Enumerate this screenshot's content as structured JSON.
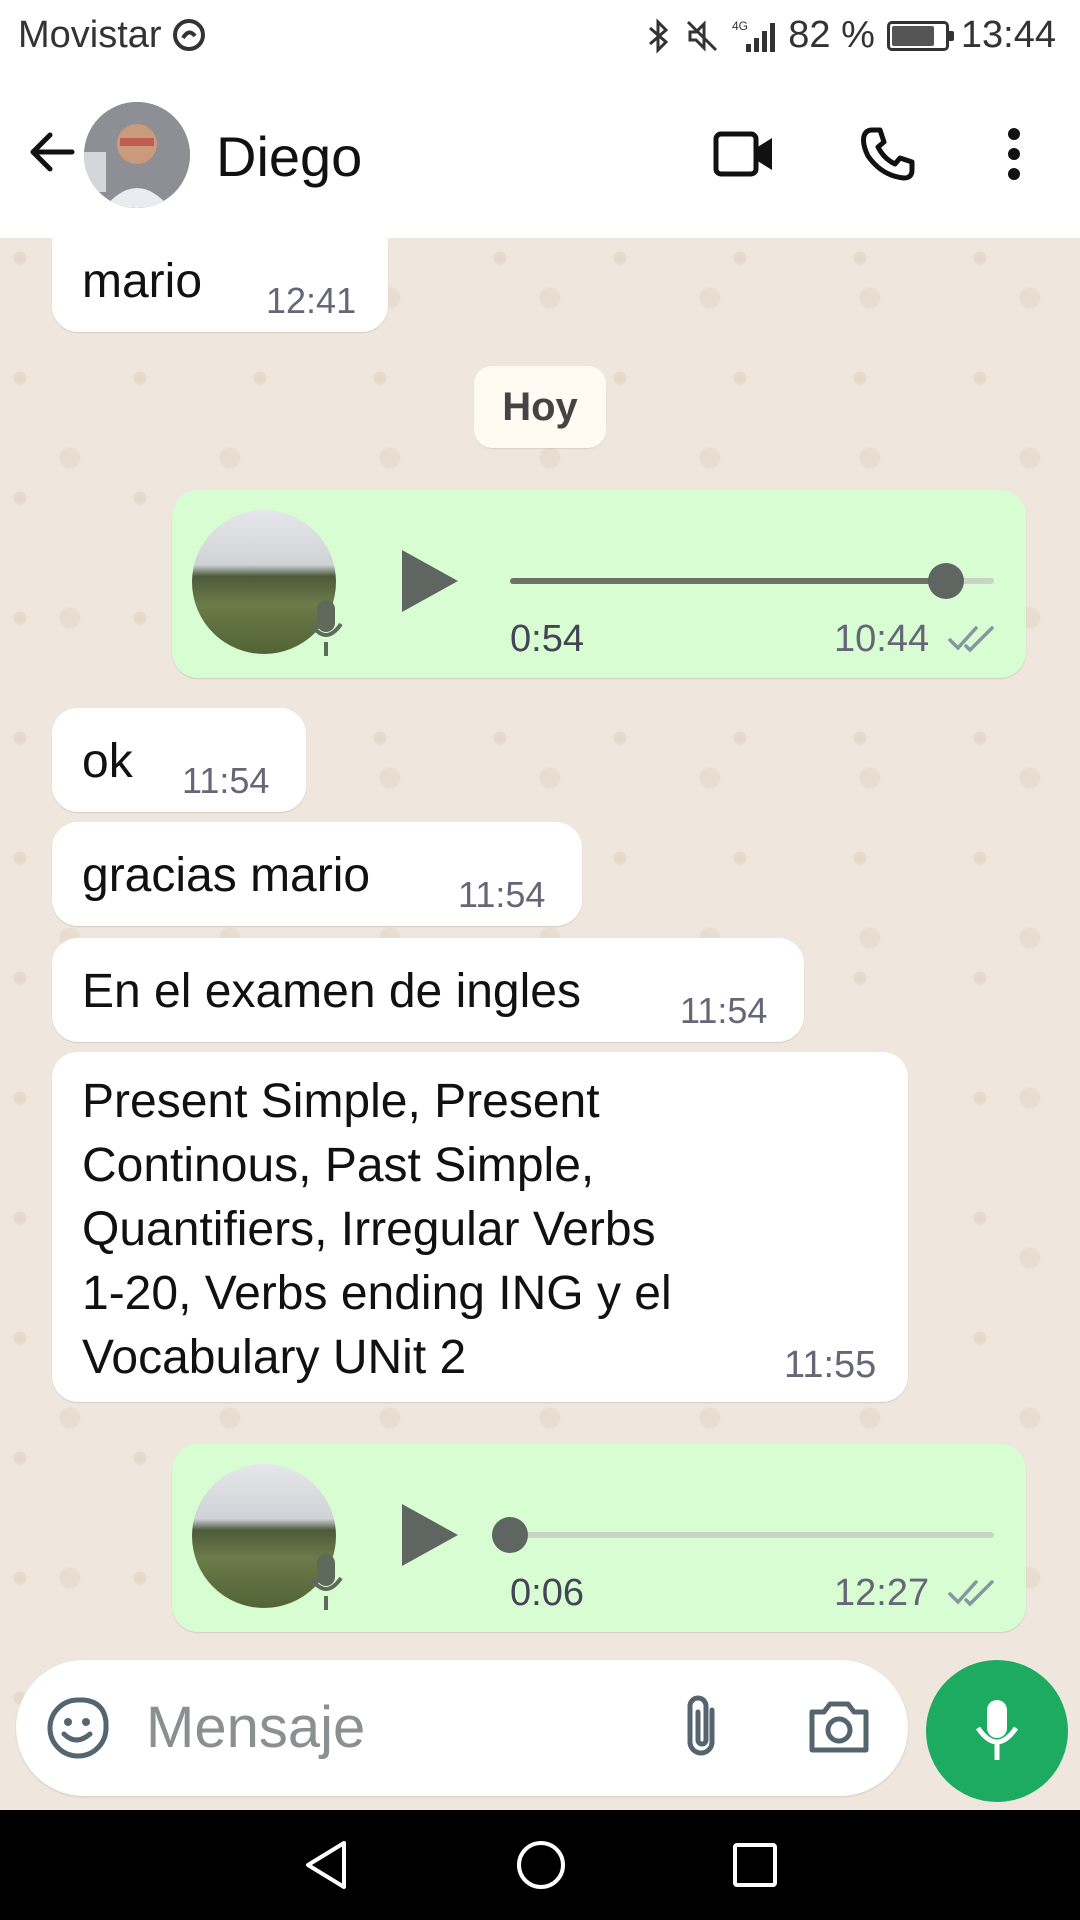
{
  "status_bar": {
    "carrier": "Movistar",
    "battery": "82 %",
    "battery_level": 0.82,
    "time": "13:44",
    "network": "4G"
  },
  "header": {
    "contact_name": "Diego"
  },
  "messages": {
    "m1": {
      "text": "mario",
      "time": "12:41"
    },
    "date_chip": "Hoy",
    "voice1": {
      "duration": "0:54",
      "time": "10:44",
      "progress": 0.9
    },
    "m2": {
      "text": "ok",
      "time": "11:54"
    },
    "m3": {
      "text": "gracias mario",
      "time": "11:54"
    },
    "m4": {
      "text": "En el examen de ingles",
      "time": "11:54"
    },
    "m5": {
      "lines": [
        "Present Simple, Present",
        "Continous, Past Simple,",
        "Quantifiers, Irregular Verbs",
        "1-20, Verbs ending ING y el",
        "Vocabulary UNit 2"
      ],
      "time": "11:55"
    },
    "voice2": {
      "duration": "0:06",
      "time": "12:27",
      "progress": 0.0
    }
  },
  "composer": {
    "placeholder": "Mensaje"
  },
  "icons": {
    "back": "back-arrow-icon",
    "video": "video-call-icon",
    "call": "phone-icon",
    "menu": "more-vert-icon",
    "emoji": "sticker-icon",
    "attach": "paperclip-icon",
    "camera": "camera-icon",
    "mic": "mic-icon"
  },
  "colors": {
    "outgoing": "#d9fdd3",
    "incoming": "#ffffff",
    "accent": "#1daa61",
    "read_ticks": "#8696a0"
  }
}
